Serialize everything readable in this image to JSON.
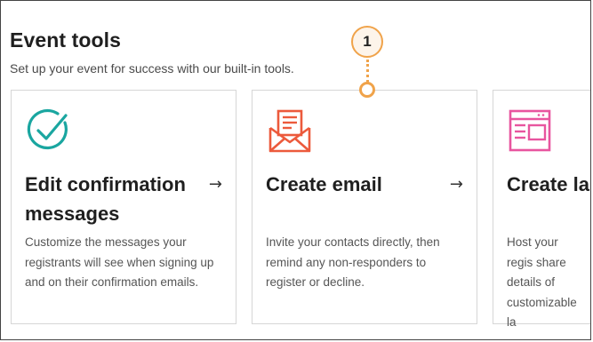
{
  "section": {
    "title": "Event tools",
    "subtitle": "Set up your event for success with our built-in tools."
  },
  "callout": {
    "number": "1"
  },
  "cards": [
    {
      "title": "Edit confirmation messages",
      "arrow": "→",
      "description": "Customize the messages your registrants will see when signing up and on their confirmation emails.",
      "icon": "checkmark-circle-icon",
      "color": "#1aa6a0"
    },
    {
      "title": "Create email",
      "arrow": "→",
      "description": "Invite your contacts directly, then remind any non-responders to register or decline.",
      "icon": "envelope-letter-icon",
      "color": "#ec5a3c"
    },
    {
      "title": "Create la page",
      "arrow": "",
      "description": "Host your regis share details of customizable la",
      "icon": "landing-page-icon",
      "color": "#e8559f"
    }
  ],
  "colors": {
    "accent": "#f0a34a",
    "border": "#d6d6d6"
  }
}
